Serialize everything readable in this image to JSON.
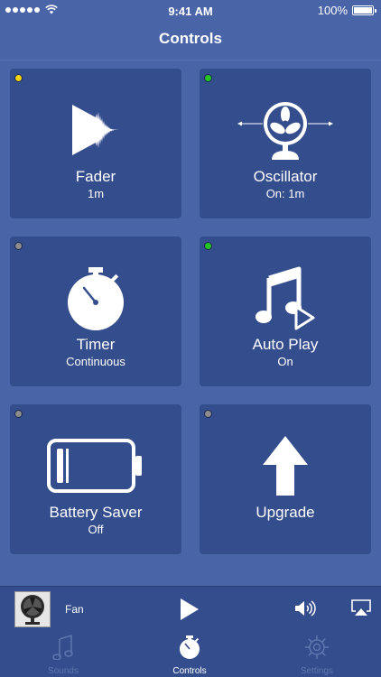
{
  "status": {
    "time": "9:41 AM",
    "battery": "100%"
  },
  "nav": {
    "title": "Controls"
  },
  "tiles": [
    {
      "title": "Fader",
      "subtitle": "1m",
      "indicator": "#f5d50a",
      "icon": "fader-icon"
    },
    {
      "title": "Oscillator",
      "subtitle": "On: 1m",
      "indicator": "#23c521",
      "icon": "fan-oscillate-icon"
    },
    {
      "title": "Timer",
      "subtitle": "Continuous",
      "indicator": "#8c8c8c",
      "icon": "stopwatch-icon"
    },
    {
      "title": "Auto Play",
      "subtitle": "On",
      "indicator": "#23c521",
      "icon": "music-play-icon"
    },
    {
      "title": "Battery Saver",
      "subtitle": "Off",
      "indicator": "#8c8c8c",
      "icon": "battery-icon"
    },
    {
      "title": "Upgrade",
      "subtitle": "",
      "indicator": "#8c8c8c",
      "icon": "arrow-up-icon"
    }
  ],
  "player": {
    "track": "Fan"
  },
  "tabs": [
    {
      "label": "Sounds",
      "active": false,
      "icon": "music-note-icon"
    },
    {
      "label": "Controls",
      "active": true,
      "icon": "stopwatch-icon"
    },
    {
      "label": "Settings",
      "active": false,
      "icon": "gear-icon"
    }
  ],
  "colors": {
    "background": "#4a64a8",
    "tile": "#344d8c",
    "inactive_tab": "#5f76ae"
  }
}
